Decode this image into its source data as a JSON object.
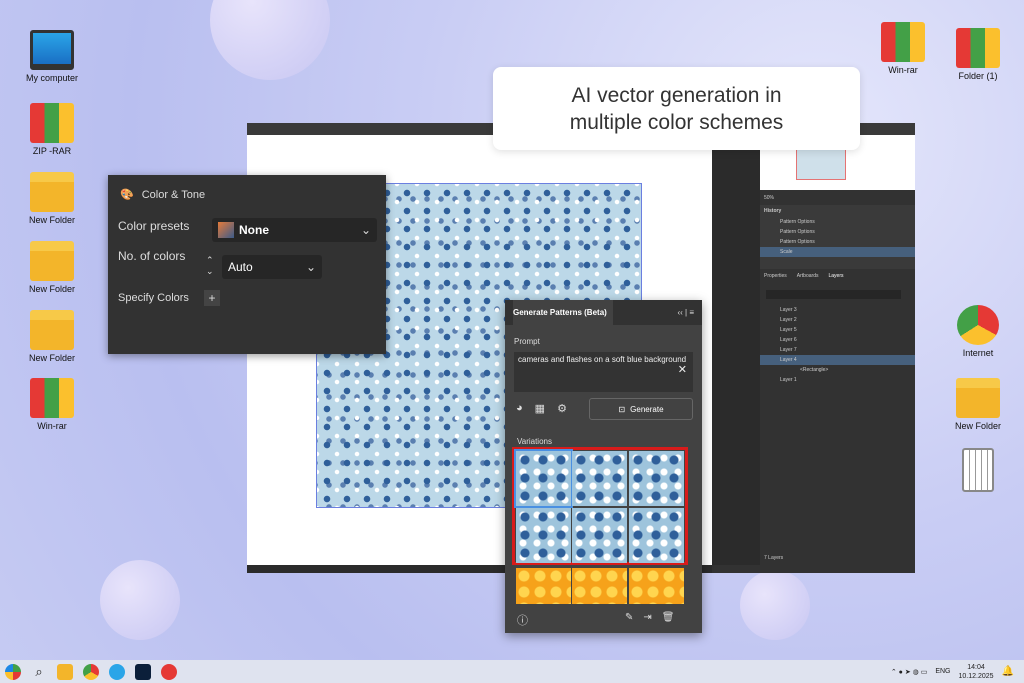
{
  "desktop": {
    "left_icons": [
      "My computer",
      "ZIP -RAR",
      "New Folder",
      "New Folder",
      "New Folder",
      "Win-rar"
    ],
    "right_icons": [
      "Win-rar",
      "Folder (1)",
      "Internet",
      "New Folder"
    ]
  },
  "callout": "AI vector generation in multiple color schemes",
  "illustrator": {
    "zoom": "50%",
    "history_title": "History",
    "history": [
      "Pattern Options",
      "Pattern Options",
      "Pattern Options",
      "Scale"
    ],
    "tabs": [
      "Properties",
      "Artboards",
      "Layers"
    ],
    "layers": [
      "Layer 3",
      "Layer 2",
      "Layer 5",
      "Layer 6",
      "Layer 7",
      "Layer 4",
      "<Rectangle>",
      "Layer 1"
    ],
    "layers_count": "7 Layers"
  },
  "color_tone": {
    "title": "Color & Tone",
    "presets_label": "Color presets",
    "presets_value": "None",
    "colors_label": "No. of colors",
    "colors_value": "Auto",
    "specify_label": "Specify Colors"
  },
  "generate": {
    "title": "Generate Patterns (Beta)",
    "prompt_label": "Prompt",
    "prompt": "cameras and flashes on a soft blue background",
    "button": "Generate",
    "variations_label": "Variations"
  },
  "taskbar": {
    "lang": "ENG",
    "time": "14:04",
    "date": "10.12.2025"
  },
  "colors": {
    "accent": "#d81b1b",
    "panel": "#424242"
  }
}
